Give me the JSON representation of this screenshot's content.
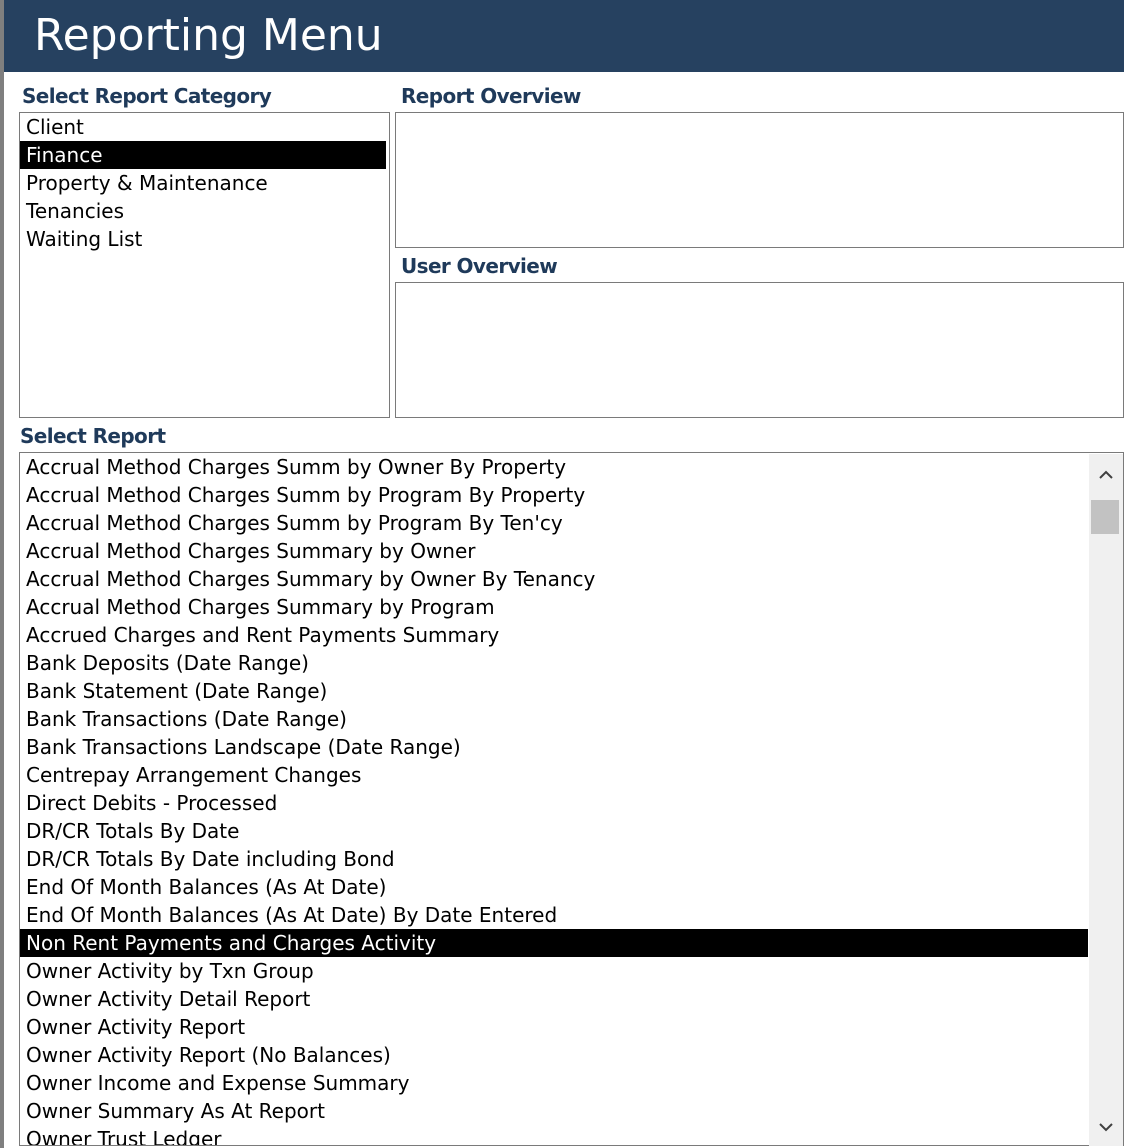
{
  "header": {
    "title": "Reporting Menu"
  },
  "labels": {
    "category": "Select Report Category",
    "overview": "Report Overview",
    "user_overview": "User Overview",
    "report": "Select Report"
  },
  "categories": {
    "items": [
      "Client",
      "Finance",
      "Property & Maintenance",
      "Tenancies",
      "Waiting List"
    ],
    "selected": "Finance"
  },
  "reports": {
    "items": [
      "Accrual Method Charges Summ by Owner By Property",
      "Accrual Method Charges Summ by Program By Property",
      "Accrual Method Charges Summ by Program By Ten'cy",
      "Accrual Method Charges Summary by Owner",
      "Accrual Method Charges Summary by Owner By Tenancy",
      "Accrual Method Charges Summary by Program",
      "Accrued Charges and Rent Payments  Summary",
      "Bank Deposits (Date Range)",
      "Bank Statement (Date Range)",
      "Bank Transactions (Date Range)",
      "Bank Transactions Landscape (Date Range)",
      "Centrepay Arrangement Changes",
      "Direct Debits - Processed",
      "DR/CR Totals By Date",
      "DR/CR Totals By Date including Bond",
      "End Of Month Balances (As At Date)",
      "End Of Month Balances (As At Date) By Date Entered",
      "Non Rent Payments and Charges Activity",
      "Owner Activity by Txn Group",
      "Owner Activity Detail Report",
      "Owner Activity Report",
      "Owner Activity Report (No Balances)",
      "Owner Income and Expense Summary",
      "Owner Summary As At Report",
      "Owner Trust Ledger"
    ],
    "selected": "Non Rent Payments and Charges Activity"
  },
  "icons": {
    "scroll_up": "chevron-up-icon",
    "scroll_down": "chevron-down-icon"
  },
  "colors": {
    "header_bg": "#264160",
    "label_text": "#1f3a5a",
    "selection_bg": "#000000"
  }
}
